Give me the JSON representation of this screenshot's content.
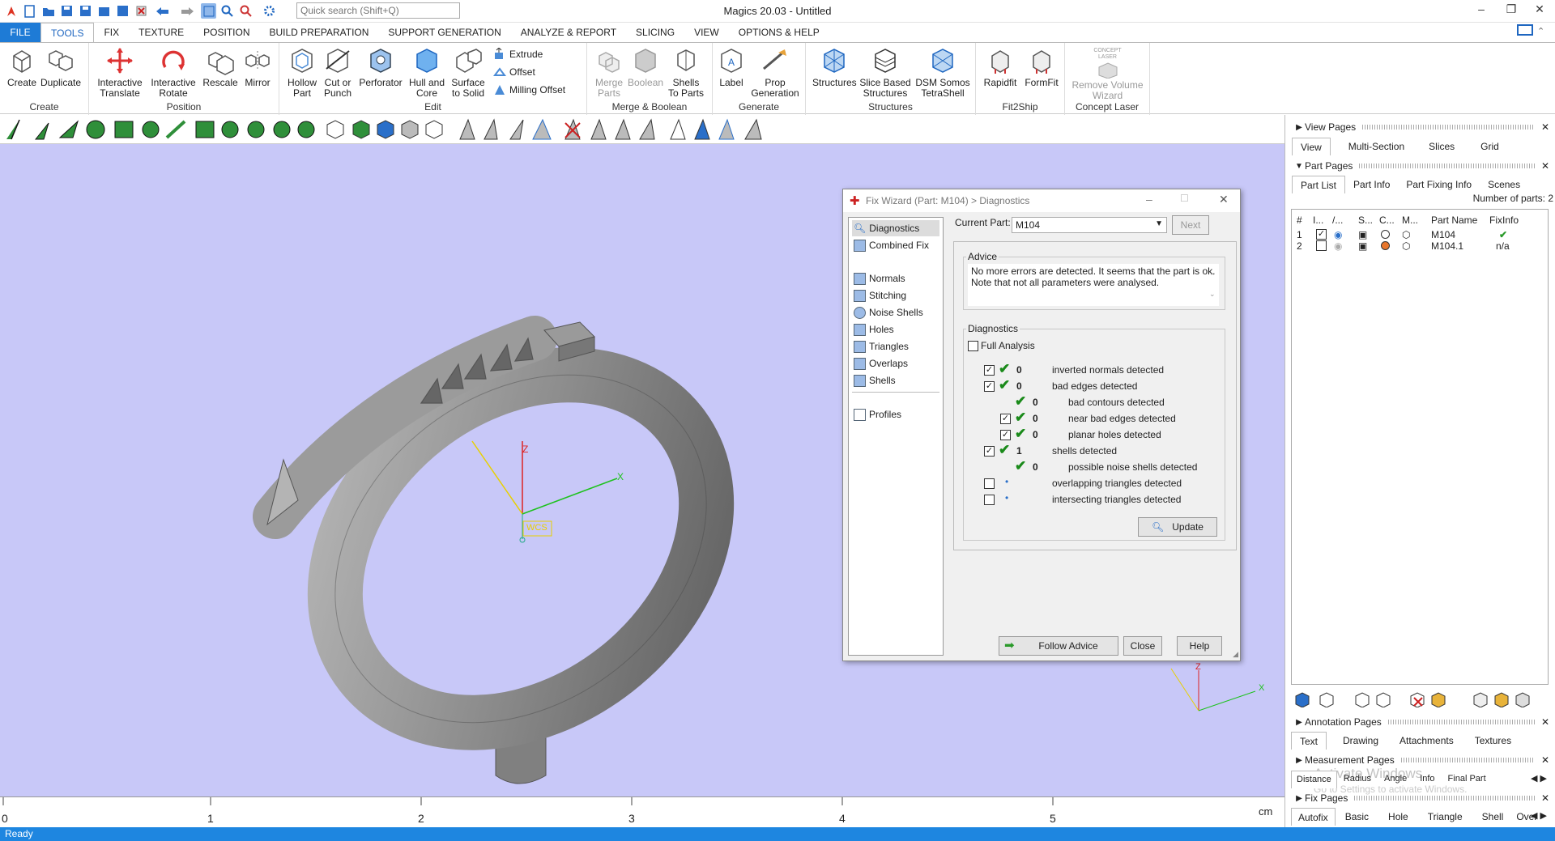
{
  "app": {
    "title": "Magics 20.03 - Untitled",
    "search_placeholder": "Quick search (Shift+Q)"
  },
  "tabs": [
    "FILE",
    "TOOLS",
    "FIX",
    "TEXTURE",
    "POSITION",
    "BUILD PREPARATION",
    "SUPPORT GENERATION",
    "ANALYZE & REPORT",
    "SLICING",
    "VIEW",
    "OPTIONS & HELP"
  ],
  "ribbon": {
    "create": {
      "label": "Create",
      "create": "Create",
      "duplicate": "Duplicate"
    },
    "position": {
      "label": "Position",
      "translate_1": "Interactive",
      "translate_2": "Translate",
      "rotate_1": "Interactive",
      "rotate_2": "Rotate",
      "rescale": "Rescale",
      "mirror": "Mirror"
    },
    "edit": {
      "label": "Edit",
      "hollow_1": "Hollow",
      "hollow_2": "Part",
      "cut_1": "Cut or",
      "cut_2": "Punch",
      "perforator": "Perforator",
      "hull_1": "Hull and",
      "hull_2": "Core",
      "surface_1": "Surface",
      "surface_2": "to Solid",
      "extrude": "Extrude",
      "offset": "Offset",
      "milling": "Milling Offset"
    },
    "merge": {
      "label": "Merge & Boolean",
      "merge_1": "Merge",
      "merge_2": "Parts",
      "boolean": "Boolean",
      "shells_1": "Shells",
      "shells_2": "To Parts"
    },
    "generate": {
      "label": "Generate",
      "label_btn": "Label",
      "prop_1": "Prop",
      "prop_2": "Generation"
    },
    "structures": {
      "label": "Structures",
      "structures": "Structures",
      "slice_1": "Slice Based",
      "slice_2": "Structures",
      "dsm_1": "DSM Somos",
      "dsm_2": "TetraShell"
    },
    "fit2ship": {
      "label": "Fit2Ship",
      "rapidfit": "Rapidfit",
      "formfit": "FormFit"
    },
    "concept": {
      "label": "Concept Laser",
      "logo_1": "CONCEPT",
      "logo_2": "LASER",
      "rv_1": "Remove Volume",
      "rv_2": "Wizard"
    }
  },
  "viewport": {
    "wcs_label": "WCS",
    "axis_z": "Z",
    "axis_x": "X"
  },
  "ruler": {
    "ticks": [
      "0",
      "1",
      "2",
      "3",
      "4",
      "5"
    ],
    "unit": "cm"
  },
  "status": "Ready",
  "right_panel": {
    "view_pages": "View Pages",
    "view_tabs": [
      "View",
      "Multi-Section",
      "Slices",
      "Grid"
    ],
    "part_pages": "Part Pages",
    "part_tabs": [
      "Part List",
      "Part Info",
      "Part Fixing Info",
      "Scenes"
    ],
    "num_parts": "Number of parts: 2",
    "columns": [
      "#",
      "I...",
      "/...",
      "S...",
      "C...",
      "M...",
      "Part Name",
      "FixInfo"
    ],
    "parts": [
      {
        "num": "1",
        "name": "M104",
        "fix": "✔",
        "selected": true,
        "color": "#ffffff"
      },
      {
        "num": "2",
        "name": "M104.1",
        "fix": "n/a",
        "selected": false,
        "color": "#e8762c"
      }
    ],
    "annotation_pages": "Annotation Pages",
    "annotation_tabs": [
      "Text",
      "Drawing",
      "Attachments",
      "Textures"
    ],
    "measurement_pages": "Measurement Pages",
    "measurement_tabs": [
      "Distance",
      "Radius",
      "Angle",
      "Info",
      "Final Part"
    ],
    "watermark_1": "Activate Windows",
    "watermark_2": "Go to Settings to activate Windows.",
    "fix_pages": "Fix Pages",
    "fix_tabs": [
      "Autofix",
      "Basic",
      "Hole",
      "Triangle",
      "Shell",
      "Over"
    ]
  },
  "dialog": {
    "title": "Fix Wizard (Part: M104) > Diagnostics",
    "nav": [
      "Diagnostics",
      "Combined Fix",
      "Normals",
      "Stitching",
      "Noise Shells",
      "Holes",
      "Triangles",
      "Overlaps",
      "Shells",
      "Profiles"
    ],
    "current_part_label": "Current Part:",
    "current_part": "M104",
    "next": "Next",
    "advice_label": "Advice",
    "advice_1": "No more errors are detected. It seems that the part is ok.",
    "advice_2": "Note that not all parameters were analysed.",
    "diagnostics_label": "Diagnostics",
    "full_analysis": "Full Analysis",
    "rows": [
      {
        "count": "0",
        "text": "inverted normals detected"
      },
      {
        "count": "0",
        "text": "bad edges detected"
      },
      {
        "count": "0",
        "text": "bad contours detected"
      },
      {
        "count": "0",
        "text": "near bad edges detected"
      },
      {
        "count": "0",
        "text": "planar holes detected"
      },
      {
        "count": "1",
        "text": "shells detected"
      },
      {
        "count": "0",
        "text": "possible noise shells detected"
      },
      {
        "count": "",
        "text": "overlapping triangles detected"
      },
      {
        "count": "",
        "text": "intersecting triangles detected"
      }
    ],
    "update": "Update",
    "follow_advice": "Follow Advice",
    "close": "Close",
    "help": "Help"
  }
}
